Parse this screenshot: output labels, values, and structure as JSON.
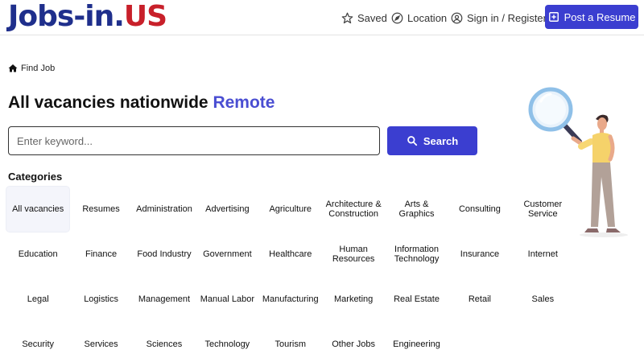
{
  "header": {
    "logo_part1": "Jobs-in.",
    "logo_part2": "US",
    "nav": {
      "saved": "Saved",
      "location": "Location",
      "sign_in": "Sign in / Register",
      "post_resume": "Post a Resume"
    }
  },
  "breadcrumb": {
    "label": "Find Job"
  },
  "title": {
    "main": "All vacancies nationwide",
    "accent": "Remote"
  },
  "search": {
    "placeholder": "Enter keyword...",
    "value": "",
    "button_label": "Search"
  },
  "categories": {
    "heading": "Categories",
    "items": [
      "All vacancies",
      "Resumes",
      "Administration",
      "Advertising",
      "Agriculture",
      "Architecture & Construction",
      "Arts & Graphics",
      "Consulting",
      "Customer Service",
      "Education",
      "Finance",
      "Food Industry",
      "Government",
      "Healthcare",
      "Human Resources",
      "Information Technology",
      "Insurance",
      "Internet",
      "Legal",
      "Logistics",
      "Management",
      "Manual Labor",
      "Manufacturing",
      "Marketing",
      "Real Estate",
      "Retail",
      "Sales",
      "Security",
      "Services",
      "Sciences",
      "Technology",
      "Tourism",
      "Other Jobs",
      "Engineering"
    ]
  },
  "colors": {
    "primary": "#3b3ed0",
    "accent_text": "#4a4ed2",
    "logo_blue": "#1f2f8c",
    "logo_red": "#c8202a"
  },
  "icons": {
    "saved": "star-icon",
    "location": "compass-icon",
    "sign_in": "user-circle-icon",
    "post_resume": "plus-square-icon",
    "breadcrumb": "home-icon",
    "search": "search-icon"
  }
}
